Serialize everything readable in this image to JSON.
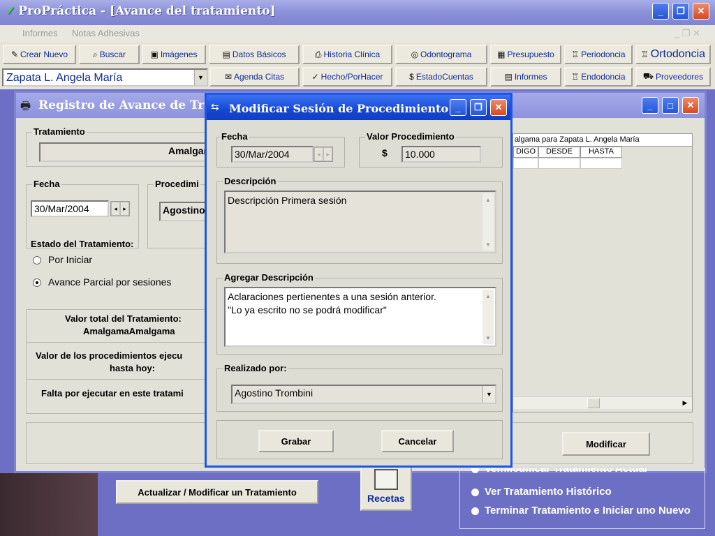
{
  "app": {
    "title": "ProPráctica - [Avance del tratamiento]",
    "check_glyph": "✓"
  },
  "menu": {
    "items": [
      "Informes",
      "Notas Adhesivas"
    ]
  },
  "toolbar": {
    "row1": [
      "Crear Nuevo",
      "Buscar",
      "Imágenes",
      "Datos Básicos",
      "Historia Clínica",
      "Odontograma",
      "Presupuesto",
      "Periodoncia",
      "Ortodoncia"
    ],
    "row2": [
      "Agenda Citas",
      "Hecho/PorHacer",
      "EstadoCuentas",
      "Informes",
      "Endodoncia",
      "Proveedores"
    ],
    "patient": "Zapata L. Angela María"
  },
  "registro": {
    "title": "Registro de Avance de Tratami",
    "tratamiento_label": "Tratamiento",
    "tratamiento_value": "Amalgam",
    "fecha_label": "Fecha",
    "fecha_value": "30/Mar/2004",
    "procedimiento_label": "Procedimi",
    "procedimiento_value": "Agostino",
    "estado_label": "Estado del Tratamiento:",
    "estado_opt1": "Por Iniciar",
    "estado_opt2": "Avance Parcial por sesiones",
    "valor_total_label": "Valor total  del Tratamiento:",
    "valor_total_value": "AmalgamaAmalgama",
    "valor_proc_label_1": "Valor de los procedimientos ejecu",
    "valor_proc_label_2": "hasta hoy:",
    "falta_label": "Falta por ejecutar en este tratami",
    "grid_title": "algama para Zapata L. Angela María",
    "grid_headers": [
      "DIGO",
      "DESDE",
      "HASTA"
    ],
    "modificar_btn": "Modificar"
  },
  "modal": {
    "title": "Modificar Sesión de Procedimiento",
    "fecha_label": "Fecha",
    "fecha_value": "30/Mar/2004",
    "valor_label": "Valor Procedimiento",
    "currency": "$",
    "valor_value": "10.000",
    "descripcion_label": "Descripción",
    "descripcion_value": "Descripción Primera sesión",
    "agregar_label": "Agregar Descripción",
    "agregar_line1": "Aclaraciones pertienentes a una sesión anterior.",
    "agregar_line2": "\"Lo ya escrito no se podrá modificar\"",
    "realizado_label": "Realizado por:",
    "realizado_value": "Agostino Trombini",
    "grabar_btn": "Grabar",
    "cancelar_btn": "Cancelar"
  },
  "bottom": {
    "actualizar_btn": "Actualizar / Modificar un Tratamiento",
    "recetas_btn": "Recetas",
    "opt_partial": "Ver/Modificar Tratamiento Actual",
    "opt1": "Ver Tratamiento Histórico",
    "opt2": "Terminar Tratamiento e Iniciar uno Nuevo"
  }
}
